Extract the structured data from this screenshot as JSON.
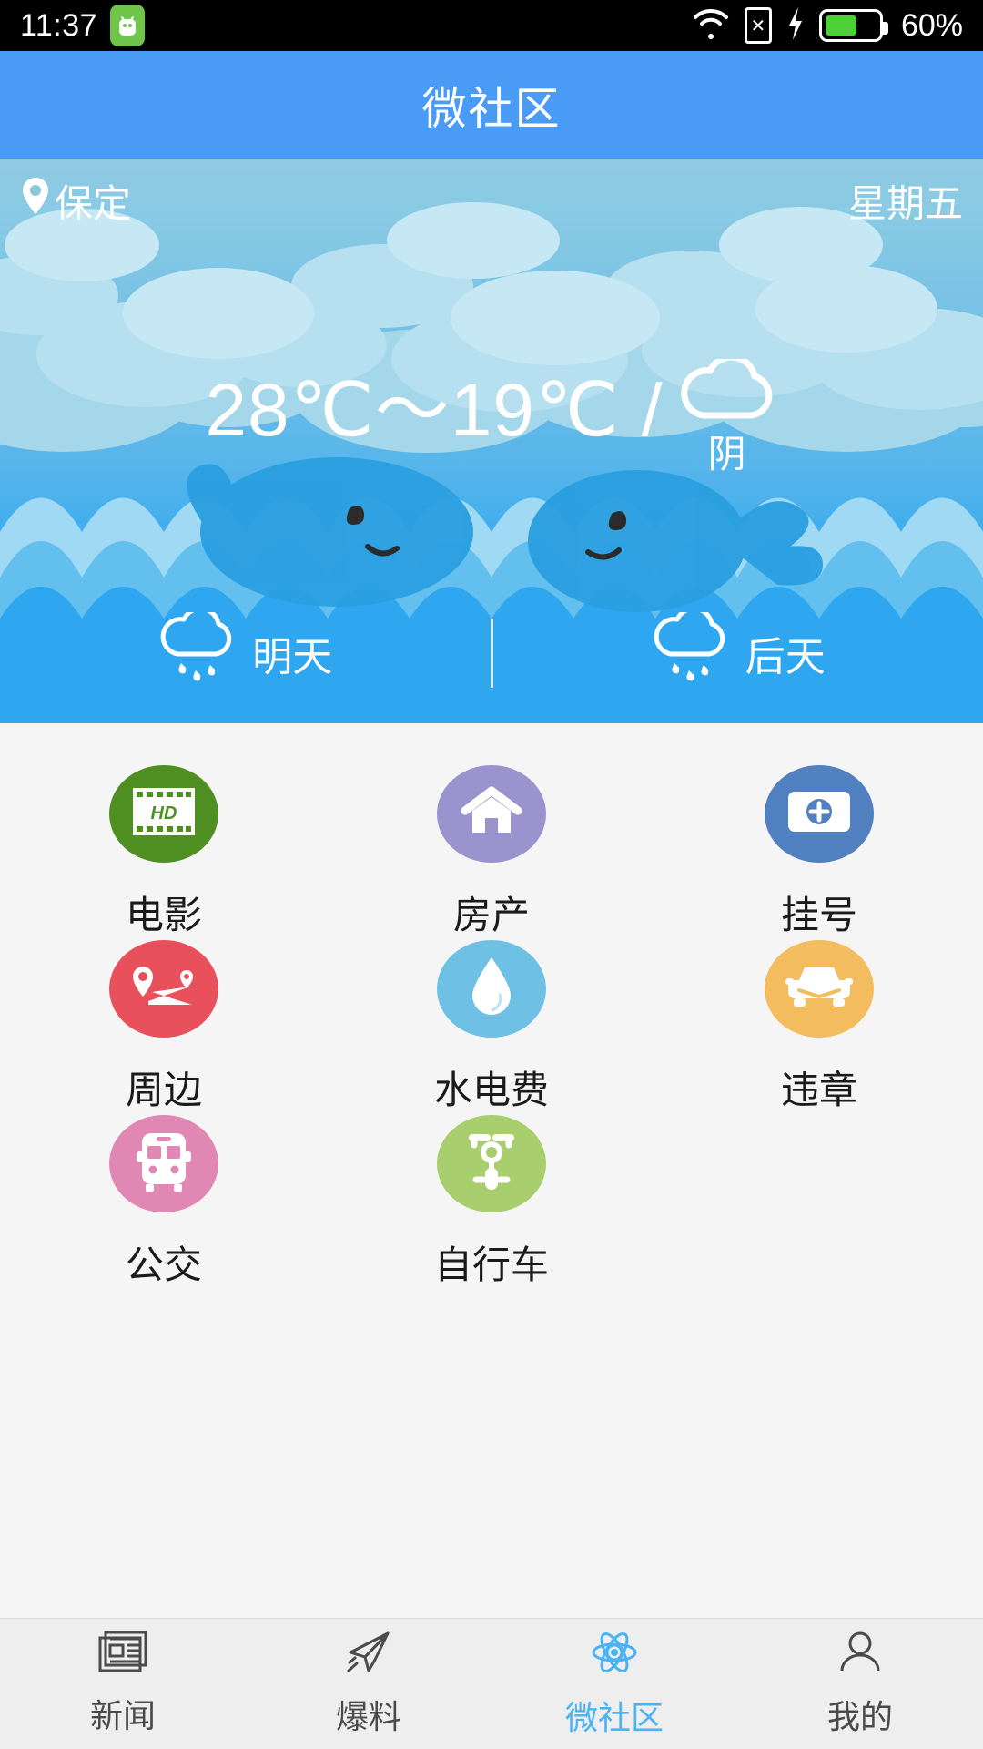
{
  "status_bar": {
    "time": "11:37",
    "battery_percent": "60%",
    "icons": [
      "android-robot-icon",
      "wifi-icon",
      "sim-x-icon",
      "charging-bolt-icon",
      "battery-icon"
    ]
  },
  "header": {
    "title": "微社区"
  },
  "weather": {
    "location": "保定",
    "location_icon": "location-pin-icon",
    "weekday": "星期五",
    "temperature_range": "28℃～19℃  /",
    "condition_label": "阴",
    "condition_icon": "cloud-icon",
    "forecast": [
      {
        "label": "明天",
        "icon": "rain-cloud-icon"
      },
      {
        "label": "后天",
        "icon": "rain-cloud-icon"
      }
    ]
  },
  "services": [
    {
      "label": "电影",
      "icon": "film-hd-icon",
      "color": "#4f8f22"
    },
    {
      "label": "房产",
      "icon": "house-icon",
      "color": "#9b93cd"
    },
    {
      "label": "挂号",
      "icon": "medical-card-icon",
      "color": "#5180c1"
    },
    {
      "label": "周边",
      "icon": "map-route-icon",
      "color": "#e8505b"
    },
    {
      "label": "水电费",
      "icon": "water-drop-icon",
      "color": "#6ec1e4"
    },
    {
      "label": "违章",
      "icon": "car-front-icon",
      "color": "#f3bc5e"
    },
    {
      "label": "公交",
      "icon": "bus-icon",
      "color": "#e087b4"
    },
    {
      "label": "自行车",
      "icon": "bicycle-icon",
      "color": "#a9ce6e"
    }
  ],
  "tabbar": {
    "active_color": "#4ab3f4",
    "items": [
      {
        "label": "新闻",
        "icon": "newspaper-icon",
        "active": false
      },
      {
        "label": "爆料",
        "icon": "paper-plane-icon",
        "active": false
      },
      {
        "label": "微社区",
        "icon": "flower-atom-icon",
        "active": true
      },
      {
        "label": "我的",
        "icon": "person-icon",
        "active": false
      }
    ]
  },
  "colors": {
    "title_bar": "#4a9bf5",
    "sky_top": "#8fcbe2",
    "sky_bottom": "#2fa6f0",
    "page_bg": "#f5f5f5",
    "tabbar_bg": "#eeeeee"
  }
}
